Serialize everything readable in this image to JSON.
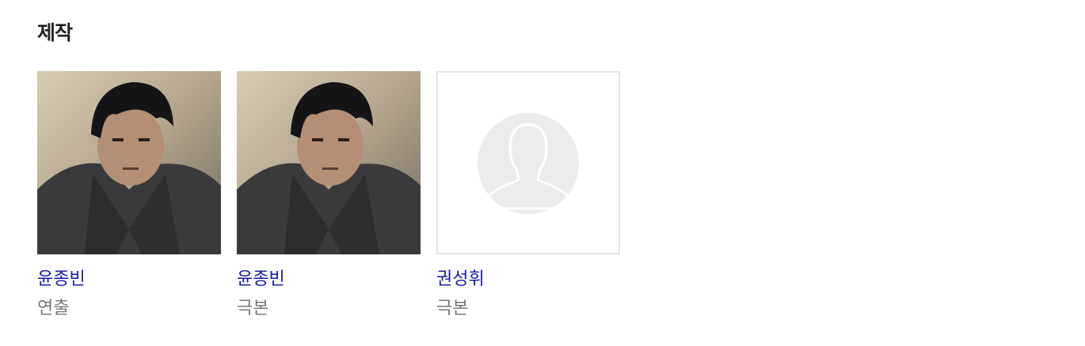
{
  "section": {
    "title": "제작"
  },
  "people": [
    {
      "name": "윤종빈",
      "role": "연출",
      "photo": "portrait-photo"
    },
    {
      "name": "윤종빈",
      "role": "극본",
      "photo": "portrait-photo"
    },
    {
      "name": "권성휘",
      "role": "극본",
      "photo": "default-avatar-icon"
    }
  ],
  "colors": {
    "name_link": "#1a1aa6",
    "role_text": "#777777",
    "title_text": "#222222",
    "placeholder_bg": "#ececec"
  }
}
